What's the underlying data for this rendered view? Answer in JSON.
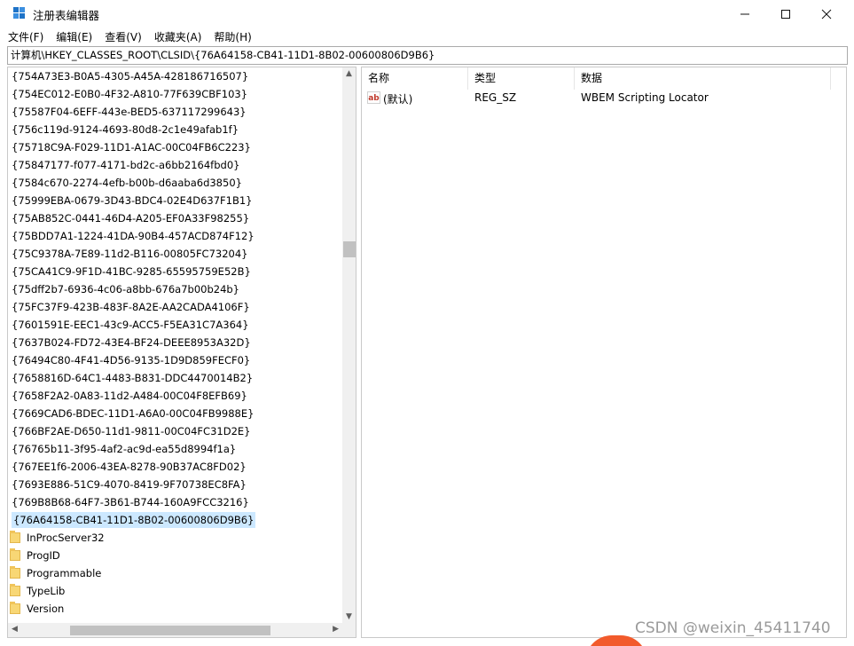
{
  "window": {
    "title": "注册表编辑器",
    "minimize": "—",
    "maximize": "☐",
    "close": "✕"
  },
  "menu": [
    "文件(F)",
    "编辑(E)",
    "查看(V)",
    "收藏夹(A)",
    "帮助(H)"
  ],
  "address": "计算机\\HKEY_CLASSES_ROOT\\CLSID\\{76A64158-CB41-11D1-8B02-00600806D9B6}",
  "tree": {
    "keys": [
      "{754A73E3-B0A5-4305-A45A-428186716507}",
      "{754EC012-E0B0-4F32-A810-77F639CBF103}",
      "{75587F04-6EFF-443e-BED5-637117299643}",
      "{756c119d-9124-4693-80d8-2c1e49afab1f}",
      "{75718C9A-F029-11D1-A1AC-00C04FB6C223}",
      "{75847177-f077-4171-bd2c-a6bb2164fbd0}",
      "{7584c670-2274-4efb-b00b-d6aaba6d3850}",
      "{75999EBA-0679-3D43-BDC4-02E4D637F1B1}",
      "{75AB852C-0441-46D4-A205-EF0A33F98255}",
      "{75BDD7A1-1224-41DA-90B4-457ACD874F12}",
      "{75C9378A-7E89-11d2-B116-00805FC73204}",
      "{75CA41C9-9F1D-41BC-9285-65595759E52B}",
      "{75dff2b7-6936-4c06-a8bb-676a7b00b24b}",
      "{75FC37F9-423B-483F-8A2E-AA2CADA4106F}",
      "{7601591E-EEC1-43c9-ACC5-F5EA31C7A364}",
      "{7637B024-FD72-43E4-BF24-DEEE8953A32D}",
      "{76494C80-4F41-4D56-9135-1D9D859FECF0}",
      "{7658816D-64C1-4483-B831-DDC4470014B2}",
      "{7658F2A2-0A83-11d2-A484-00C04F8EFB69}",
      "{7669CAD6-BDEC-11D1-A6A0-00C04FB9988E}",
      "{766BF2AE-D650-11d1-9811-00C04FC31D2E}",
      "{76765b11-3f95-4af2-ac9d-ea55d8994f1a}",
      "{767EE1f6-2006-43EA-8278-90B37AC8FD02}",
      "{7693E886-51C9-4070-8419-9F70738EC8FA}",
      "{769B8B68-64F7-3B61-B744-160A9FCC3216}",
      "{76A64158-CB41-11D1-8B02-00600806D9B6}"
    ],
    "selected_index": 25,
    "subkeys": [
      "InProcServer32",
      "ProgID",
      "Programmable",
      "TypeLib",
      "Version"
    ]
  },
  "values": {
    "columns": [
      "名称",
      "类型",
      "数据"
    ],
    "rows": [
      {
        "name": "(默认)",
        "type": "REG_SZ",
        "data": "WBEM Scripting Locator",
        "icon": "ab"
      }
    ]
  },
  "watermark": "CSDN @weixin_45411740"
}
